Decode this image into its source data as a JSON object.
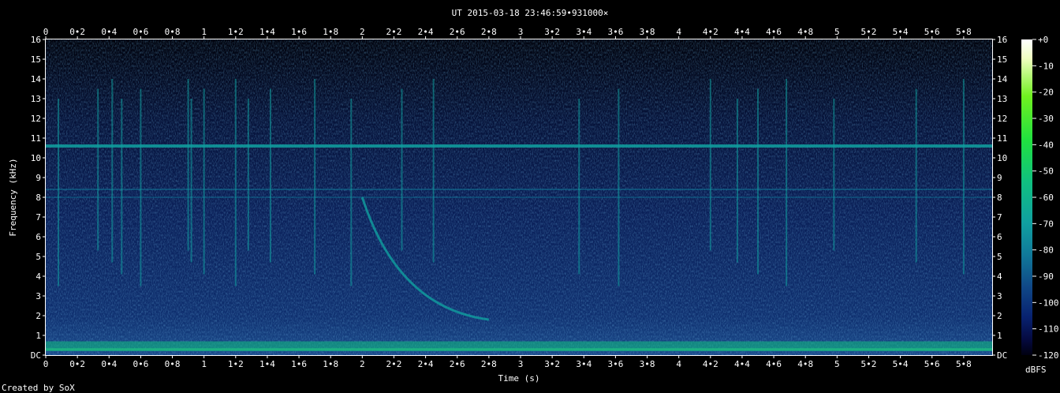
{
  "chart_data": {
    "type": "heatmap",
    "title": "UT 2015-03-18 23:46:59•931000×",
    "xlabel": "Time (s)",
    "ylabel": "Frequency (kHz)",
    "xlim": [
      0,
      5.98
    ],
    "ylim": [
      0,
      16
    ],
    "x_ticks": [
      "0",
      "0•2",
      "0•4",
      "0•6",
      "0•8",
      "1",
      "1•2",
      "1•4",
      "1•6",
      "1•8",
      "2",
      "2•2",
      "2•4",
      "2•6",
      "2•8",
      "3",
      "3•2",
      "3•4",
      "3•6",
      "3•8",
      "4",
      "4•2",
      "4•4",
      "4•6",
      "4•8",
      "5",
      "5•2",
      "5•4",
      "5•6",
      "5•8"
    ],
    "y_ticks": [
      "DC",
      "1",
      "2",
      "3",
      "4",
      "5",
      "6",
      "7",
      "8",
      "9",
      "10",
      "11",
      "12",
      "13",
      "14",
      "15",
      "16"
    ],
    "colorbar": {
      "label": "dBFS",
      "range": [
        -120,
        0
      ],
      "ticks": [
        "+0",
        "-10",
        "-20",
        "-30",
        "-40",
        "-50",
        "-60",
        "-70",
        "-80",
        "-90",
        "-100",
        "-110",
        "-120"
      ],
      "colors": [
        "#ffffff",
        "#d8ffa0",
        "#70f020",
        "#20e040",
        "#10c080",
        "#10a0a0",
        "#107a9a",
        "#104a88",
        "#082270",
        "#050a40",
        "#000010"
      ]
    },
    "features": {
      "hum_line_khz": 10.6,
      "whistler": {
        "start_s": 2.0,
        "start_khz": 8.0,
        "end_s": 2.8,
        "end_khz": 1.8
      },
      "impulses_s": [
        0.08,
        0.33,
        0.42,
        0.48,
        0.6,
        0.9,
        0.92,
        1.0,
        1.2,
        1.28,
        1.42,
        1.7,
        1.93,
        2.25,
        2.45,
        3.37,
        3.62,
        4.2,
        4.37,
        4.5,
        4.68,
        4.98,
        5.5,
        5.8
      ]
    }
  },
  "footer": {
    "credit": "Created by SoX"
  }
}
